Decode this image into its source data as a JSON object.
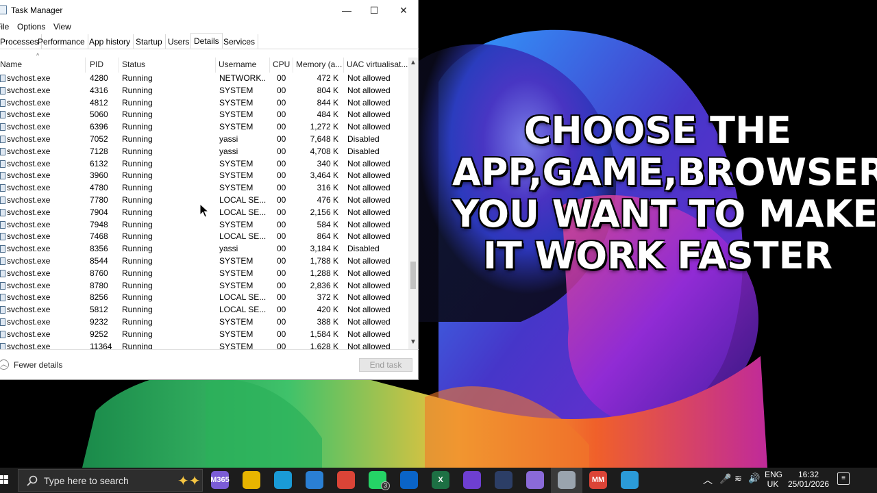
{
  "window": {
    "title": "Task Manager",
    "minimize_label": "—",
    "maximize_label": "☐",
    "close_label": "✕"
  },
  "menu": [
    "File",
    "Options",
    "View"
  ],
  "tabs": [
    {
      "label": "Processes",
      "active": false
    },
    {
      "label": "Performance",
      "active": false
    },
    {
      "label": "App history",
      "active": false
    },
    {
      "label": "Startup",
      "active": false
    },
    {
      "label": "Users",
      "active": false
    },
    {
      "label": "Details",
      "active": true
    },
    {
      "label": "Services",
      "active": false
    }
  ],
  "columns": {
    "name": "Name",
    "pid": "PID",
    "status": "Status",
    "username": "Username",
    "cpu": "CPU",
    "memory": "Memory (a...",
    "uac": "UAC virtualisat..."
  },
  "rows": [
    {
      "name": "svchost.exe",
      "pid": "4280",
      "status": "Running",
      "user": "NETWORK...",
      "cpu": "00",
      "mem": "472 K",
      "uac": "Not allowed"
    },
    {
      "name": "svchost.exe",
      "pid": "4316",
      "status": "Running",
      "user": "SYSTEM",
      "cpu": "00",
      "mem": "804 K",
      "uac": "Not allowed"
    },
    {
      "name": "svchost.exe",
      "pid": "4812",
      "status": "Running",
      "user": "SYSTEM",
      "cpu": "00",
      "mem": "844 K",
      "uac": "Not allowed"
    },
    {
      "name": "svchost.exe",
      "pid": "5060",
      "status": "Running",
      "user": "SYSTEM",
      "cpu": "00",
      "mem": "484 K",
      "uac": "Not allowed"
    },
    {
      "name": "svchost.exe",
      "pid": "6396",
      "status": "Running",
      "user": "SYSTEM",
      "cpu": "00",
      "mem": "1,272 K",
      "uac": "Not allowed"
    },
    {
      "name": "svchost.exe",
      "pid": "7052",
      "status": "Running",
      "user": "yassi",
      "cpu": "00",
      "mem": "7,648 K",
      "uac": "Disabled"
    },
    {
      "name": "svchost.exe",
      "pid": "7128",
      "status": "Running",
      "user": "yassi",
      "cpu": "00",
      "mem": "4,708 K",
      "uac": "Disabled"
    },
    {
      "name": "svchost.exe",
      "pid": "6132",
      "status": "Running",
      "user": "SYSTEM",
      "cpu": "00",
      "mem": "340 K",
      "uac": "Not allowed"
    },
    {
      "name": "svchost.exe",
      "pid": "3960",
      "status": "Running",
      "user": "SYSTEM",
      "cpu": "00",
      "mem": "3,464 K",
      "uac": "Not allowed"
    },
    {
      "name": "svchost.exe",
      "pid": "4780",
      "status": "Running",
      "user": "SYSTEM",
      "cpu": "00",
      "mem": "316 K",
      "uac": "Not allowed"
    },
    {
      "name": "svchost.exe",
      "pid": "7780",
      "status": "Running",
      "user": "LOCAL SE...",
      "cpu": "00",
      "mem": "476 K",
      "uac": "Not allowed"
    },
    {
      "name": "svchost.exe",
      "pid": "7904",
      "status": "Running",
      "user": "LOCAL SE...",
      "cpu": "00",
      "mem": "2,156 K",
      "uac": "Not allowed"
    },
    {
      "name": "svchost.exe",
      "pid": "7948",
      "status": "Running",
      "user": "SYSTEM",
      "cpu": "00",
      "mem": "584 K",
      "uac": "Not allowed"
    },
    {
      "name": "svchost.exe",
      "pid": "7468",
      "status": "Running",
      "user": "LOCAL SE...",
      "cpu": "00",
      "mem": "864 K",
      "uac": "Not allowed"
    },
    {
      "name": "svchost.exe",
      "pid": "8356",
      "status": "Running",
      "user": "yassi",
      "cpu": "00",
      "mem": "3,184 K",
      "uac": "Disabled"
    },
    {
      "name": "svchost.exe",
      "pid": "8544",
      "status": "Running",
      "user": "SYSTEM",
      "cpu": "00",
      "mem": "1,788 K",
      "uac": "Not allowed"
    },
    {
      "name": "svchost.exe",
      "pid": "8760",
      "status": "Running",
      "user": "SYSTEM",
      "cpu": "00",
      "mem": "1,288 K",
      "uac": "Not allowed"
    },
    {
      "name": "svchost.exe",
      "pid": "8780",
      "status": "Running",
      "user": "SYSTEM",
      "cpu": "00",
      "mem": "2,836 K",
      "uac": "Not allowed"
    },
    {
      "name": "svchost.exe",
      "pid": "8256",
      "status": "Running",
      "user": "LOCAL SE...",
      "cpu": "00",
      "mem": "372 K",
      "uac": "Not allowed"
    },
    {
      "name": "svchost.exe",
      "pid": "5812",
      "status": "Running",
      "user": "LOCAL SE...",
      "cpu": "00",
      "mem": "420 K",
      "uac": "Not allowed"
    },
    {
      "name": "svchost.exe",
      "pid": "9232",
      "status": "Running",
      "user": "SYSTEM",
      "cpu": "00",
      "mem": "388 K",
      "uac": "Not allowed"
    },
    {
      "name": "svchost.exe",
      "pid": "9252",
      "status": "Running",
      "user": "SYSTEM",
      "cpu": "00",
      "mem": "1,584 K",
      "uac": "Not allowed"
    },
    {
      "name": "svchost.exe",
      "pid": "11364",
      "status": "Running",
      "user": "SYSTEM",
      "cpu": "00",
      "mem": "1,628 K",
      "uac": "Not allowed"
    }
  ],
  "footer": {
    "fewer_details": "Fewer details",
    "end_task": "End task"
  },
  "caption": {
    "lines": [
      "CHOOSE THE",
      "APP,GAME,BROWSER",
      "YOU WANT TO MAKE",
      "IT WORK FASTER"
    ]
  },
  "taskbar": {
    "search_placeholder": "Type here to search",
    "icons": [
      {
        "name": "m365-icon",
        "label": "M365",
        "color": "#7b5cd6"
      },
      {
        "name": "file-explorer-icon",
        "label": "",
        "color": "#e8b400"
      },
      {
        "name": "edge-icon",
        "label": "",
        "color": "#1a9bd7"
      },
      {
        "name": "store-icon",
        "label": "",
        "color": "#2a7fd4"
      },
      {
        "name": "chrome-icon",
        "label": "",
        "color": "#db4437"
      },
      {
        "name": "whatsapp-icon",
        "label": "",
        "color": "#25d366",
        "badge": "3"
      },
      {
        "name": "outlook-icon",
        "label": "",
        "color": "#0a64c8"
      },
      {
        "name": "excel-icon",
        "label": "X",
        "color": "#1d7044"
      },
      {
        "name": "clipchamp-icon",
        "label": "",
        "color": "#6e3fd1"
      },
      {
        "name": "game-icon",
        "label": "",
        "color": "#2c3e66"
      },
      {
        "name": "paint-icon",
        "label": "",
        "color": "#8a6ad8"
      },
      {
        "name": "task-manager-icon",
        "label": "",
        "color": "#9aa4ae",
        "active": true
      },
      {
        "name": "chrome-profile-icon",
        "label": "MM",
        "color": "#db4437"
      },
      {
        "name": "remote-desktop-icon",
        "label": "",
        "color": "#2b9bd8"
      }
    ],
    "language_top": "ENG",
    "language_bottom": "UK",
    "time": "16:32",
    "date": "25/01/2026"
  }
}
